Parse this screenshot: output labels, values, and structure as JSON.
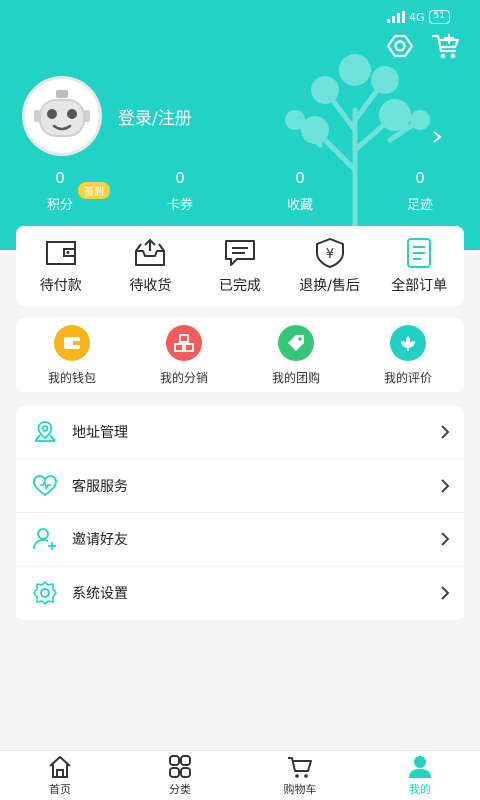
{
  "status_bar": {
    "network": "4G",
    "battery": "51"
  },
  "header": {
    "login_label": "登录/注册",
    "sign_badge": "签到",
    "stats": [
      {
        "value": "0",
        "label": "积分"
      },
      {
        "value": "0",
        "label": "卡券"
      },
      {
        "value": "0",
        "label": "收藏"
      },
      {
        "value": "0",
        "label": "足迹"
      }
    ]
  },
  "orders": [
    {
      "label": "待付款",
      "icon": "wallet-icon"
    },
    {
      "label": "待收货",
      "icon": "inbox-icon"
    },
    {
      "label": "已完成",
      "icon": "message-icon"
    },
    {
      "label": "退换/售后",
      "icon": "shield-yen-icon"
    },
    {
      "label": "全部订单",
      "icon": "document-icon"
    }
  ],
  "services": [
    {
      "label": "我的钱包",
      "icon": "wallet-icon",
      "color": "#f6b51c"
    },
    {
      "label": "我的分销",
      "icon": "boxes-icon",
      "color": "#f15b5b"
    },
    {
      "label": "我的团购",
      "icon": "tag-icon",
      "color": "#35c777"
    },
    {
      "label": "我的评价",
      "icon": "flower-icon",
      "color": "#22cfc5"
    }
  ],
  "menu": [
    {
      "label": "地址管理",
      "icon": "location-icon"
    },
    {
      "label": "客服服务",
      "icon": "heart-icon"
    },
    {
      "label": "邀请好友",
      "icon": "add-user-icon"
    },
    {
      "label": "系统设置",
      "icon": "gear-icon"
    }
  ],
  "tabs": [
    {
      "label": "首页",
      "icon": "home-icon"
    },
    {
      "label": "分类",
      "icon": "grid-icon"
    },
    {
      "label": "购物车",
      "icon": "cart-icon"
    },
    {
      "label": "我的",
      "icon": "person-icon"
    }
  ],
  "colors": {
    "accent": "#22d3c5"
  }
}
